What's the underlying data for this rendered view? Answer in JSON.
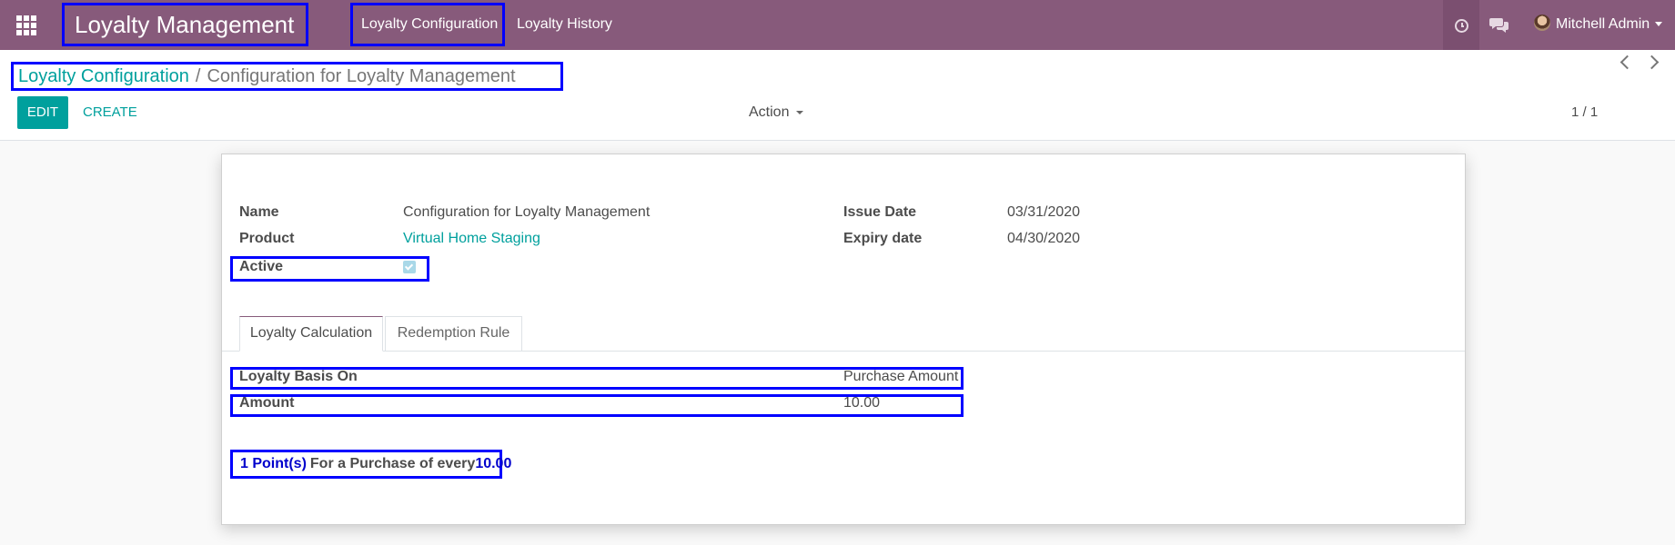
{
  "navbar": {
    "brand": "Loyalty Management",
    "menu": [
      "Loyalty Configuration",
      "Loyalty History"
    ],
    "user_name": "Mitchell Admin"
  },
  "breadcrumb": {
    "parent": "Loyalty Configuration",
    "separator": "/",
    "current": "Configuration for Loyalty Management"
  },
  "control_panel": {
    "edit_label": "EDIT",
    "create_label": "CREATE",
    "action_label": "Action",
    "pager": "1 / 1"
  },
  "form": {
    "name_label": "Name",
    "name_value": "Configuration for Loyalty Management",
    "product_label": "Product",
    "product_value": "Virtual Home Staging",
    "active_label": "Active",
    "active_checked": true,
    "issue_date_label": "Issue Date",
    "issue_date_value": "03/31/2020",
    "expiry_date_label": "Expiry date",
    "expiry_date_value": "04/30/2020"
  },
  "tabs": [
    "Loyalty Calculation",
    "Redemption Rule"
  ],
  "loyalty_calc": {
    "basis_label": "Loyalty Basis On",
    "basis_value": "Purchase Amount",
    "amount_label": "Amount",
    "amount_value": "10.00",
    "summary_points": "1 Point(s)",
    "summary_text": "For a Purchase of every",
    "summary_amount": "10.00"
  },
  "colors": {
    "navbar": "#875a7b",
    "accent": "#00a09d",
    "highlight": "#0000ff"
  }
}
